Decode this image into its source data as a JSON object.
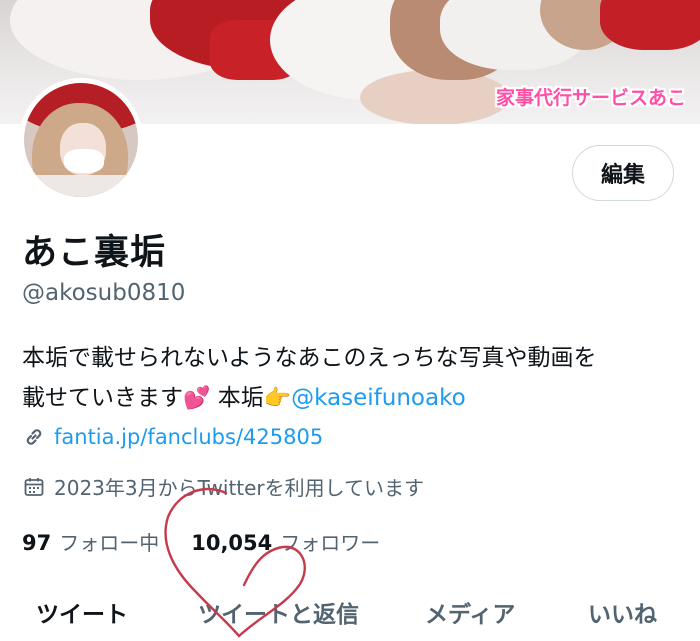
{
  "banner": {
    "caption": "家事代行サービスあこ"
  },
  "profile": {
    "edit_label": "編集",
    "display_name": "あこ裏垢",
    "handle": "@akosub0810",
    "bio_line1": "本垢で載せられないようなあこのえっちな写真や動画を",
    "bio_line2_prefix": "載せていきます",
    "bio_emoji_hearts": "💕",
    "bio_line2_mid": "本垢",
    "bio_emoji_point": "👉",
    "bio_mention": "@kaseifunoako",
    "link": "fantia.jp/fanclubs/425805",
    "joined": "2023年3月からTwitterを利用しています"
  },
  "stats": {
    "following_count": "97",
    "following_label": "フォロー中",
    "followers_count": "10,054",
    "followers_label": "フォロワー"
  },
  "tabs": [
    {
      "label": "ツイート"
    },
    {
      "label": "ツイートと返信"
    },
    {
      "label": "メディア"
    },
    {
      "label": "いいね"
    }
  ],
  "icons": [
    "link-icon",
    "calendar-icon"
  ],
  "colors": {
    "accent": "#1d9bf0",
    "secondary_text": "#536471",
    "caption": "#ff4fa6",
    "annotation": "#c63a4d"
  }
}
